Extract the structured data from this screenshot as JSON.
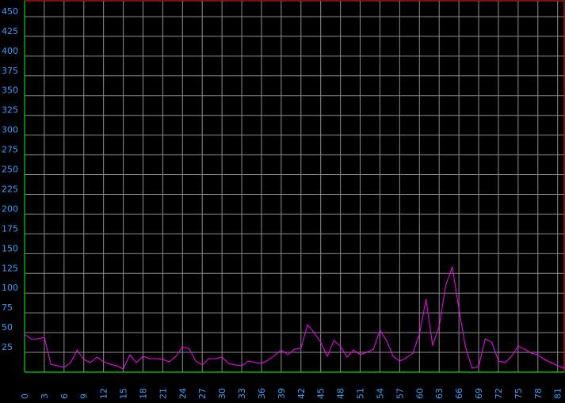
{
  "colors": {
    "background": "#000000",
    "grid": "#8c8c8c",
    "frame": "#ff2020",
    "baseline": "#00d800",
    "line": "#ff00ff",
    "tick_text": "#3aa0ff"
  },
  "chart_data": {
    "type": "line",
    "title": "",
    "xlabel": "",
    "ylabel": "",
    "xlim": [
      0,
      82
    ],
    "ylim": [
      0,
      470
    ],
    "grid": true,
    "legend": "none",
    "y_ticks": [
      25,
      50,
      75,
      100,
      125,
      150,
      175,
      200,
      225,
      250,
      275,
      300,
      325,
      350,
      375,
      400,
      425,
      450
    ],
    "y_tick_labels": [
      "25",
      "50",
      "75",
      "100",
      "125",
      "150",
      "175",
      "200",
      "225",
      "250",
      "275",
      "300",
      "325",
      "350",
      "375",
      "400",
      "425",
      "450"
    ],
    "x_ticks": [
      0,
      3,
      6,
      9,
      12,
      15,
      18,
      21,
      24,
      27,
      30,
      33,
      36,
      39,
      42,
      45,
      48,
      51,
      54,
      57,
      60,
      63,
      66,
      69,
      72,
      75,
      78,
      81
    ],
    "x_tick_labels": [
      "0",
      "3",
      "6",
      "9",
      "12",
      "15",
      "18",
      "21",
      "24",
      "27",
      "30",
      "33",
      "36",
      "39",
      "42",
      "45",
      "48",
      "51",
      "54",
      "57",
      "60",
      "63",
      "66",
      "69",
      "72",
      "75",
      "78",
      "81"
    ],
    "series": [
      {
        "x": [
          0,
          1,
          2,
          3,
          4,
          5,
          6,
          7,
          8,
          9,
          10,
          11,
          12,
          13,
          14,
          15,
          16,
          17,
          18,
          19,
          20,
          21,
          22,
          23,
          24,
          25,
          26,
          27,
          28,
          29,
          30,
          31,
          32,
          33,
          34,
          35,
          36,
          37,
          38,
          39,
          40,
          41,
          42,
          43,
          44,
          45,
          46,
          47,
          48,
          49,
          50,
          51,
          52,
          53,
          54,
          55,
          56,
          57,
          58,
          59,
          60,
          61,
          62,
          63,
          64,
          65,
          66,
          67,
          68,
          69,
          70,
          71,
          72,
          73,
          74,
          75,
          76,
          77,
          78,
          79,
          80,
          81,
          82
        ],
        "values": [
          48,
          42,
          42,
          44,
          10,
          8,
          6,
          12,
          28,
          16,
          12,
          19,
          13,
          10,
          8,
          4,
          22,
          12,
          20,
          17,
          17,
          16,
          13,
          20,
          32,
          30,
          14,
          9,
          17,
          17,
          19,
          11,
          9,
          8,
          14,
          12,
          11,
          15,
          21,
          28,
          22,
          29,
          30,
          60,
          50,
          38,
          20,
          40,
          33,
          19,
          28,
          22,
          25,
          29,
          53,
          40,
          20,
          14,
          18,
          24,
          48,
          92,
          34,
          58,
          110,
          133,
          80,
          32,
          5,
          7,
          42,
          38,
          14,
          12,
          20,
          33,
          29,
          24,
          22,
          16,
          12,
          8,
          5
        ]
      }
    ]
  }
}
